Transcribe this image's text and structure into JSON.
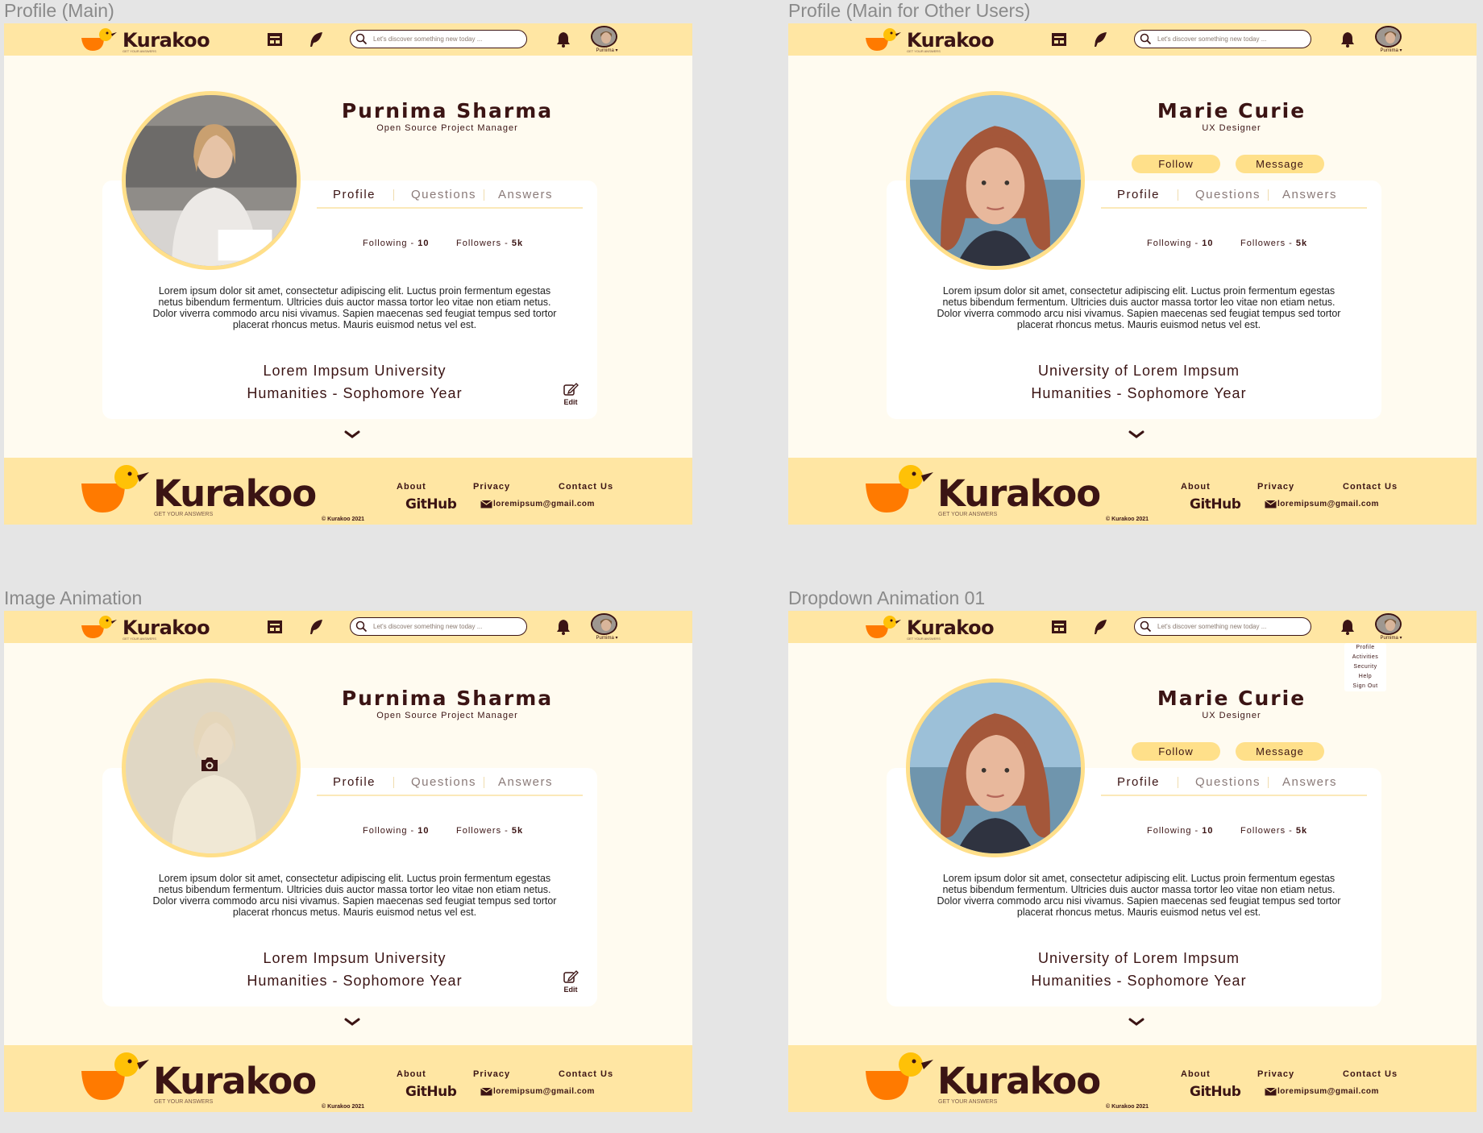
{
  "frames": [
    {
      "label": "Profile (Main)",
      "brand": "Kurakoo",
      "tagline": "GET YOUR ANSWERS",
      "search_placeholder": "Let's discover something new today ...",
      "avatar_label": "Purnima",
      "name": "Purnima Sharma",
      "role": "Open Source Project Manager",
      "tabs": [
        "Profile",
        "Questions",
        "Answers"
      ],
      "following_label": "Following - ",
      "following_count": "10",
      "followers_label": "Followers - ",
      "followers_count": "5k",
      "bio": "Lorem ipsum dolor sit amet, consectetur adipiscing elit. Luctus proin fermentum egestas netus bibendum fermentum. Ultricies duis auctor massa tortor leo vitae non etiam netus. Dolor viverra commodo arcu nisi vivamus. Sapien maecenas sed feugiat tempus sed tortor placerat rhoncus metus. Mauris euismod netus vel est.",
      "university": "Lorem Impsum University",
      "major": "Humanities - Sophomore Year",
      "edit_label": "Edit",
      "footer": {
        "about": "About",
        "privacy": "Privacy",
        "contact": "Contact Us",
        "github": "GitHub",
        "email": "loremipsum@gmail.com",
        "copyright": "© Kurakoo 2021"
      }
    },
    {
      "label": "Profile (Main for Other Users)",
      "brand": "Kurakoo",
      "tagline": "GET YOUR ANSWERS",
      "search_placeholder": "Let's discover something new today ...",
      "avatar_label": "Purnima",
      "name": "Marie Curie",
      "role": "UX Designer",
      "follow_button": "Follow",
      "message_button": "Message",
      "tabs": [
        "Profile",
        "Questions",
        "Answers"
      ],
      "following_label": "Following - ",
      "following_count": "10",
      "followers_label": "Followers - ",
      "followers_count": "5k",
      "bio": "Lorem ipsum dolor sit amet, consectetur adipiscing elit. Luctus proin fermentum egestas netus bibendum fermentum. Ultricies duis auctor massa tortor leo vitae non etiam netus. Dolor viverra commodo arcu nisi vivamus. Sapien maecenas sed feugiat tempus sed tortor placerat rhoncus metus. Mauris euismod netus vel est.",
      "university": "University of Lorem Impsum",
      "major": "Humanities - Sophomore Year",
      "footer": {
        "about": "About",
        "privacy": "Privacy",
        "contact": "Contact Us",
        "github": "GitHub",
        "email": "loremipsum@gmail.com",
        "copyright": "© Kurakoo 2021"
      }
    },
    {
      "label": "Image Animation",
      "brand": "Kurakoo",
      "tagline": "GET YOUR ANSWERS",
      "search_placeholder": "Let's discover something new today ...",
      "avatar_label": "Purnima",
      "name": "Purnima Sharma",
      "role": "Open Source Project Manager",
      "tabs": [
        "Profile",
        "Questions",
        "Answers"
      ],
      "following_label": "Following - ",
      "following_count": "10",
      "followers_label": "Followers - ",
      "followers_count": "5k",
      "bio": "Lorem ipsum dolor sit amet, consectetur adipiscing elit. Luctus proin fermentum egestas netus bibendum fermentum. Ultricies duis auctor massa tortor leo vitae non etiam netus. Dolor viverra commodo arcu nisi vivamus. Sapien maecenas sed feugiat tempus sed tortor placerat rhoncus metus. Mauris euismod netus vel est.",
      "university": "Lorem Impsum University",
      "major": "Humanities - Sophomore Year",
      "edit_label": "Edit",
      "footer": {
        "about": "About",
        "privacy": "Privacy",
        "contact": "Contact Us",
        "github": "GitHub",
        "email": "loremipsum@gmail.com",
        "copyright": "© Kurakoo 2021"
      }
    },
    {
      "label": "Dropdown Animation 01",
      "brand": "Kurakoo",
      "tagline": "GET YOUR ANSWERS",
      "search_placeholder": "Let's discover something new today ...",
      "avatar_label": "Purnima",
      "dropdown_items": [
        "Profile",
        "Activities",
        "Security",
        "Help",
        "Sign Out"
      ],
      "name": "Marie Curie",
      "role": "UX Designer",
      "follow_button": "Follow",
      "message_button": "Message",
      "tabs": [
        "Profile",
        "Questions",
        "Answers"
      ],
      "following_label": "Following - ",
      "following_count": "10",
      "followers_label": "Followers - ",
      "followers_count": "5k",
      "bio": "Lorem ipsum dolor sit amet, consectetur adipiscing elit. Luctus proin fermentum egestas netus bibendum fermentum. Ultricies duis auctor massa tortor leo vitae non etiam netus. Dolor viverra commodo arcu nisi vivamus. Sapien maecenas sed feugiat tempus sed tortor placerat rhoncus metus. Mauris euismod netus vel est.",
      "university": "University of Lorem Impsum",
      "major": "Humanities - Sophomore Year",
      "footer": {
        "about": "About",
        "privacy": "Privacy",
        "contact": "Contact Us",
        "github": "GitHub",
        "email": "loremipsum@gmail.com",
        "copyright": "© Kurakoo 2021"
      }
    }
  ],
  "colors": {
    "canvas": "#e5e5e5",
    "header": "#ffe6a3",
    "page_bg": "#fffbf0",
    "brand_text": "#3b1414",
    "accent_orange": "#ff7a00",
    "duck_yellow": "#ffc107",
    "pill": "#ffe08a",
    "photo_ring": "#ffdf8a"
  }
}
